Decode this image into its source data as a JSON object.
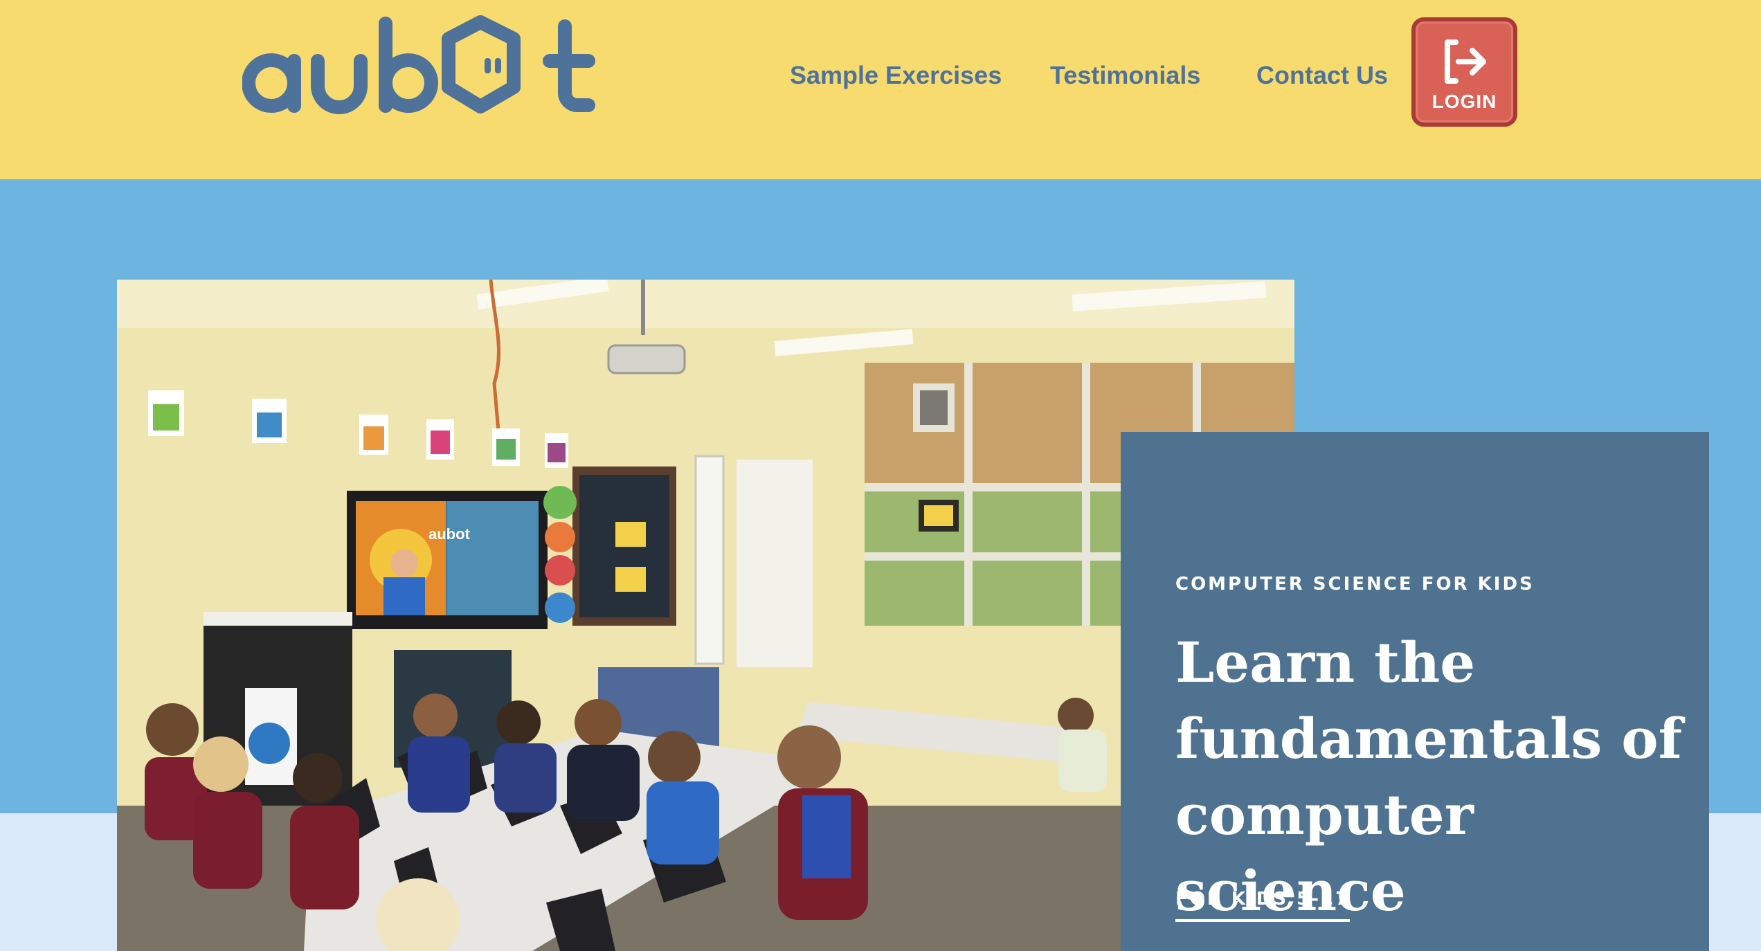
{
  "header": {
    "logo_text": "aubot",
    "nav": [
      {
        "label": "Sample Exercises"
      },
      {
        "label": "Testimonials"
      },
      {
        "label": "Contact Us"
      }
    ],
    "login_label": "LOGIN",
    "login_icon": "sign-in-arrow-icon"
  },
  "hero": {
    "image_description_name": "classroom-photo",
    "screen_logo_text": "aubot",
    "eyebrow": "COMPUTER SCIENCE FOR KIDS",
    "headline": "Learn the fundamentals of computer science",
    "age_link": "FOR KIDS 5-17"
  },
  "colors": {
    "header_bg": "#f8db6e",
    "hero_bg": "#6eb4e0",
    "card_bg": "#4f7290",
    "nav_text": "#4e7299",
    "login_bg": "#d96156",
    "lower_band": "#dbeafa"
  }
}
